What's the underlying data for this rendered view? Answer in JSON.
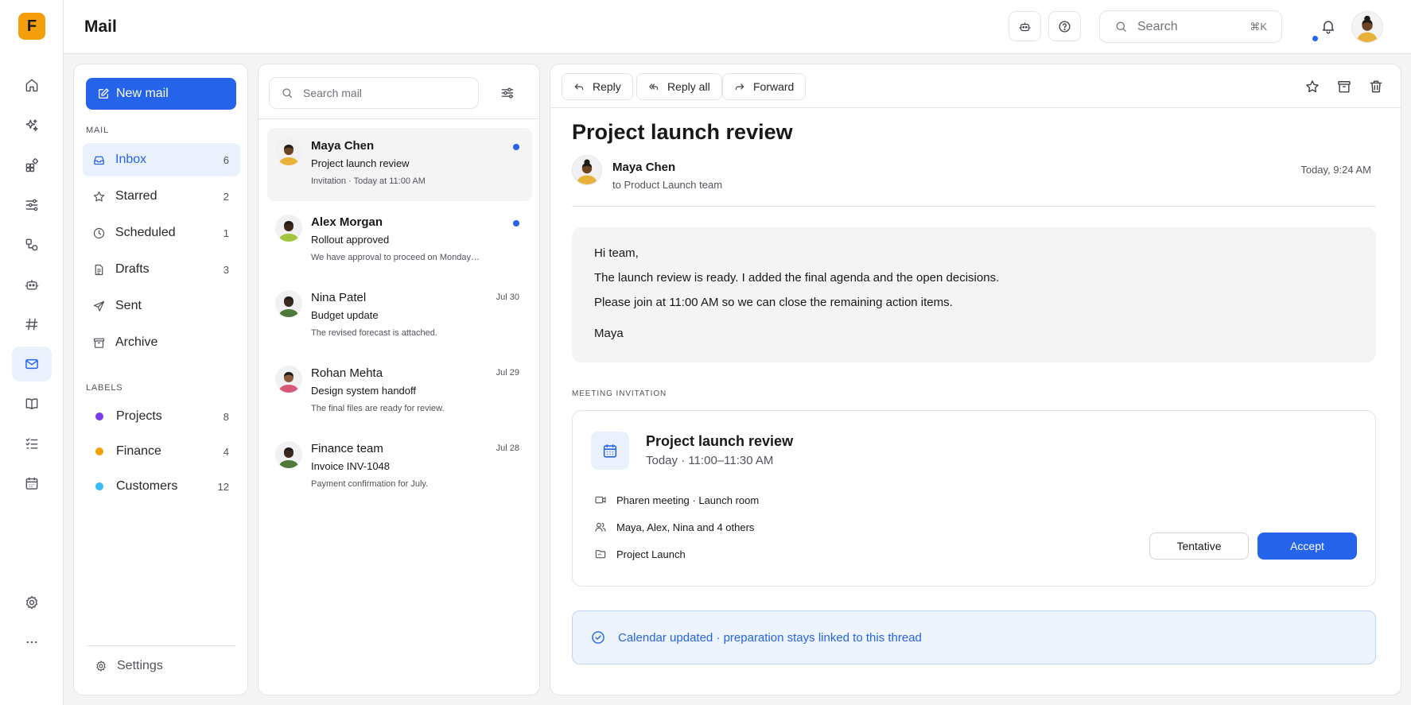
{
  "app": {
    "logo_letter": "F",
    "page_title": "Mail"
  },
  "rail": {
    "items": [
      {
        "icon": "home-icon"
      },
      {
        "icon": "sparkles-icon"
      },
      {
        "icon": "widgets-icon"
      },
      {
        "icon": "sliders-icon"
      },
      {
        "icon": "shapes-icon"
      },
      {
        "icon": "robot-icon"
      },
      {
        "icon": "hash-icon"
      },
      {
        "icon": "mail-icon",
        "active": true
      },
      {
        "icon": "book-icon"
      },
      {
        "icon": "checklist-icon"
      },
      {
        "icon": "calendar-icon"
      },
      {
        "icon": "gear-icon"
      },
      {
        "icon": "more-icon"
      }
    ]
  },
  "topbar": {
    "search_placeholder": "Search",
    "shortcut": "⌘K"
  },
  "nav": {
    "new_mail": "New mail",
    "mail_section": "MAIL",
    "folders": [
      {
        "label": "Inbox",
        "count": "6",
        "active": true,
        "icon": "inbox-icon"
      },
      {
        "label": "Starred",
        "count": "2",
        "icon": "star-icon"
      },
      {
        "label": "Scheduled",
        "count": "1",
        "icon": "clock-icon"
      },
      {
        "label": "Drafts",
        "count": "3",
        "icon": "document-icon"
      },
      {
        "label": "Sent",
        "count": "",
        "icon": "send-icon"
      },
      {
        "label": "Archive",
        "count": "",
        "icon": "archive-icon"
      }
    ],
    "labels_section": "LABELS",
    "labels": [
      {
        "label": "Projects",
        "count": "8",
        "color": "#7c3aed"
      },
      {
        "label": "Finance",
        "count": "4",
        "color": "#f59e0b"
      },
      {
        "label": "Customers",
        "count": "12",
        "color": "#38bdf8"
      }
    ],
    "settings": "Settings"
  },
  "list": {
    "search_placeholder": "Search mail",
    "items": [
      {
        "sender": "Maya Chen",
        "subject": "Project launch review",
        "preview": "Invitation · Today at 11:00 AM",
        "date": "",
        "unread": true,
        "selected": true,
        "avatar_color": "#e8b23a",
        "skin": "#6b4423"
      },
      {
        "sender": "Alex Morgan",
        "subject": "Rollout approved",
        "preview": "We have approval to proceed on Monday…",
        "date": "",
        "unread": true,
        "avatar_color": "#a3c43d",
        "skin": "#3d2817"
      },
      {
        "sender": "Nina Patel",
        "subject": "Budget update",
        "preview": "The revised forecast is attached.",
        "date": "Jul 30",
        "unread": false,
        "avatar_color": "#4f7a3a",
        "skin": "#3a2a1e"
      },
      {
        "sender": "Rohan Mehta",
        "subject": "Design system handoff",
        "preview": "The final files are ready for review.",
        "date": "Jul 29",
        "unread": false,
        "avatar_color": "#d9587a",
        "skin": "#8a5a3c"
      },
      {
        "sender": "Finance team",
        "subject": "Invoice INV-1048",
        "preview": "Payment confirmation for July.",
        "date": "Jul 28",
        "unread": false,
        "avatar_color": "#4f7a3a",
        "skin": "#3a2a1e"
      }
    ]
  },
  "reader": {
    "reply": "Reply",
    "reply_all": "Reply all",
    "forward": "Forward",
    "subject": "Project launch review",
    "sender": "Maya Chen",
    "to": "to Product Launch team",
    "time": "Today, 9:24 AM",
    "body": [
      "Hi team,",
      "The launch review is ready. I added the final agenda and the open decisions.",
      "Please join at 11:00 AM so we can close the remaining action items.",
      "Maya"
    ],
    "invite_label": "MEETING INVITATION",
    "invite": {
      "title": "Project launch review",
      "when": "Today · 11:00–11:30 AM",
      "location": "Pharen meeting · Launch room",
      "attendees": "Maya, Alex, Nina and 4 others",
      "folder": "Project Launch",
      "tentative": "Tentative",
      "accept": "Accept"
    },
    "notice": "Calendar updated · preparation stays linked to this thread"
  },
  "colors": {
    "accent": "#2563eb",
    "logo": "#f59e0b"
  }
}
